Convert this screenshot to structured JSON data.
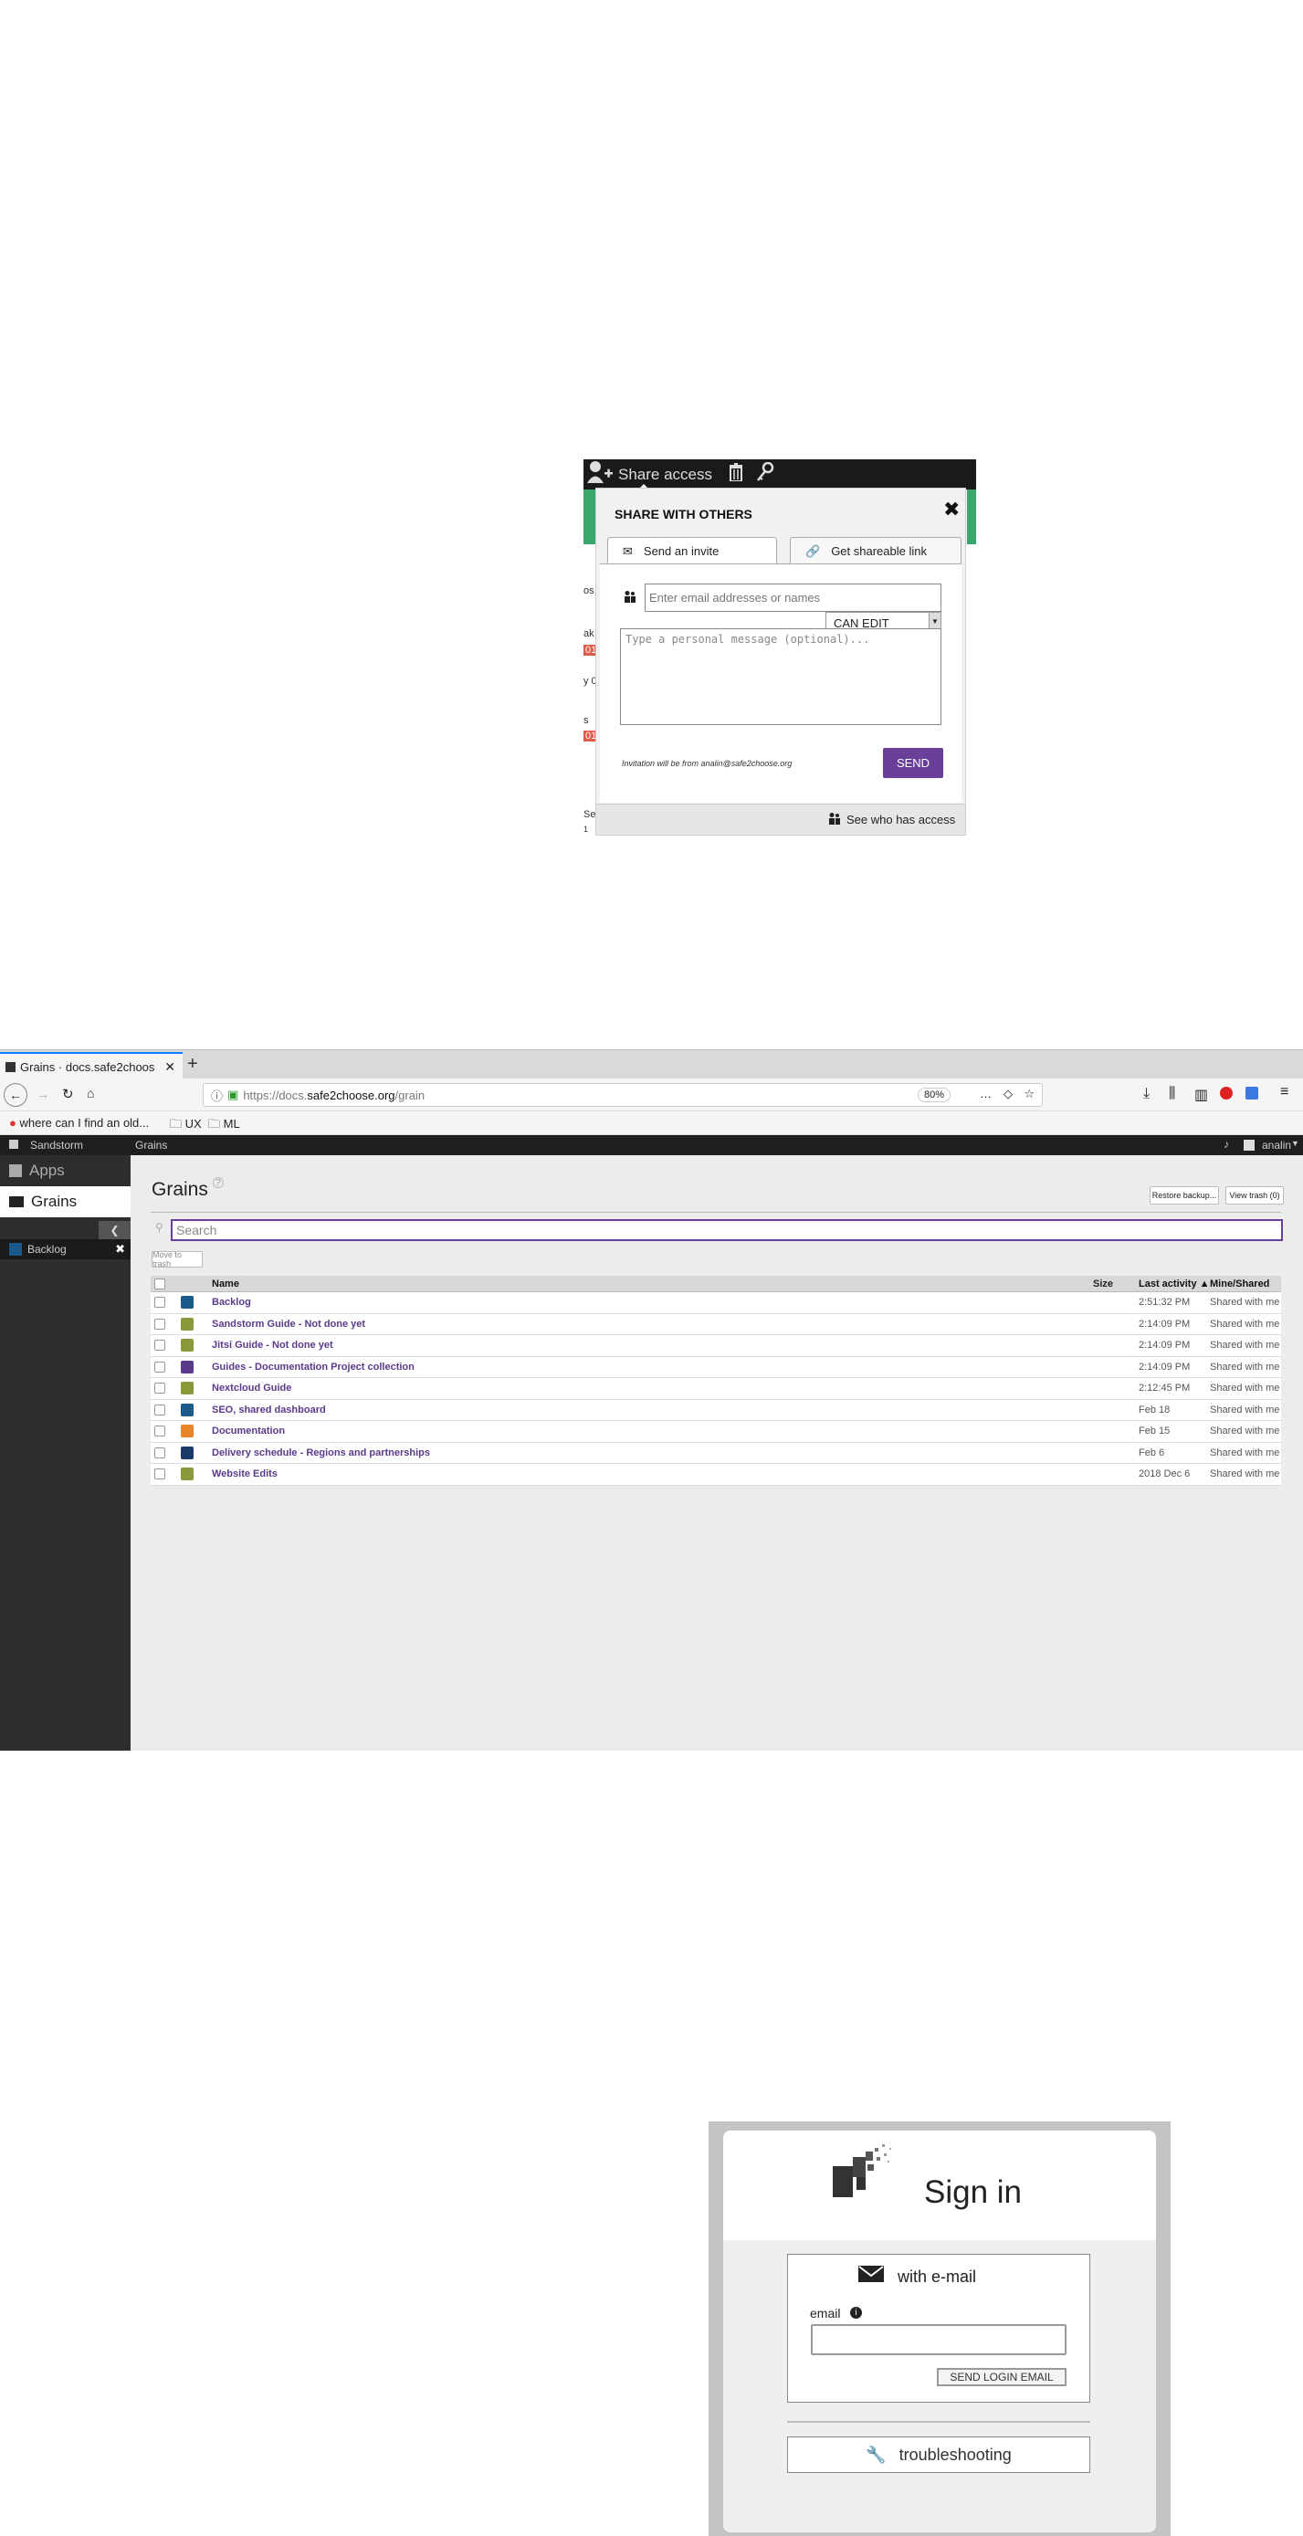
{
  "share": {
    "topbar": {
      "share_access": "Share access"
    },
    "title": "SHARE WITH OTHERS",
    "tabs": {
      "invite": "Send an invite",
      "link": "Get shareable link"
    },
    "email_placeholder": "Enter email addresses or names",
    "permission": "CAN EDIT",
    "message_placeholder": "Type a personal message (optional)...",
    "invitation_from": "Invitation will be from analin@safe2choose.org",
    "send_label": "SEND",
    "see_who": "See who has access",
    "bg_fragments": {
      "a": "os",
      "b": "ak",
      "c": "01",
      "d": "y 0",
      "e": "s",
      "f": "01",
      "g": "Se",
      "h": "1"
    }
  },
  "browser": {
    "tab_title": "Grains · docs.safe2choos",
    "new_tab": "+",
    "url_prefix": "https://docs.",
    "url_domain": "safe2choose.org",
    "url_path": "/grain",
    "zoom": "80%",
    "bookmarks": [
      "where can I find an old...",
      "UX",
      "ML"
    ],
    "sandstorm": {
      "brand": "Sandstorm",
      "crumb": "Grains",
      "user": "analin"
    },
    "sidebar": {
      "apps": "Apps",
      "grains": "Grains",
      "open_grain": "Backlog"
    },
    "main": {
      "title": "Grains",
      "help": "?",
      "restore_label": "Restore backup...",
      "trash_label": "View trash (0)",
      "search_placeholder": "Search",
      "move_trash": "Move to trash",
      "columns": {
        "name": "Name",
        "size": "Size",
        "activity": "Last activity ▲",
        "mine": "Mine/Shared"
      },
      "grains": [
        {
          "name": "Backlog",
          "activity": "2:51:32 PM",
          "mine": "Shared with me",
          "icon_color": "#1a5a8a"
        },
        {
          "name": "Sandstorm Guide - Not done yet",
          "activity": "2:14:09 PM",
          "mine": "Shared with me",
          "icon_color": "#8a9a3a"
        },
        {
          "name": "Jitsi Guide - Not done yet",
          "activity": "2:14:09 PM",
          "mine": "Shared with me",
          "icon_color": "#8a9a3a"
        },
        {
          "name": "Guides - Documentation Project collection",
          "activity": "2:14:09 PM",
          "mine": "Shared with me",
          "icon_color": "#5a3a8a"
        },
        {
          "name": "Nextcloud Guide",
          "activity": "2:12:45 PM",
          "mine": "Shared with me",
          "icon_color": "#8a9a3a"
        },
        {
          "name": "SEO, shared dashboard",
          "activity": "Feb 18",
          "mine": "Shared with me",
          "icon_color": "#1a5a8a"
        },
        {
          "name": "Documentation",
          "activity": "Feb 15",
          "mine": "Shared with me",
          "icon_color": "#e8862a"
        },
        {
          "name": "Delivery schedule - Regions and partnerships",
          "activity": "Feb 6",
          "mine": "Shared with me",
          "icon_color": "#1a3a6a"
        },
        {
          "name": "Website Edits",
          "activity": "2018 Dec 6",
          "mine": "Shared with me",
          "icon_color": "#8a9a3a"
        }
      ]
    }
  },
  "signin": {
    "title": "Sign in",
    "with_email": "with e-mail",
    "email_label": "email",
    "send_login": "SEND LOGIN EMAIL",
    "troubleshooting": "troubleshooting"
  }
}
